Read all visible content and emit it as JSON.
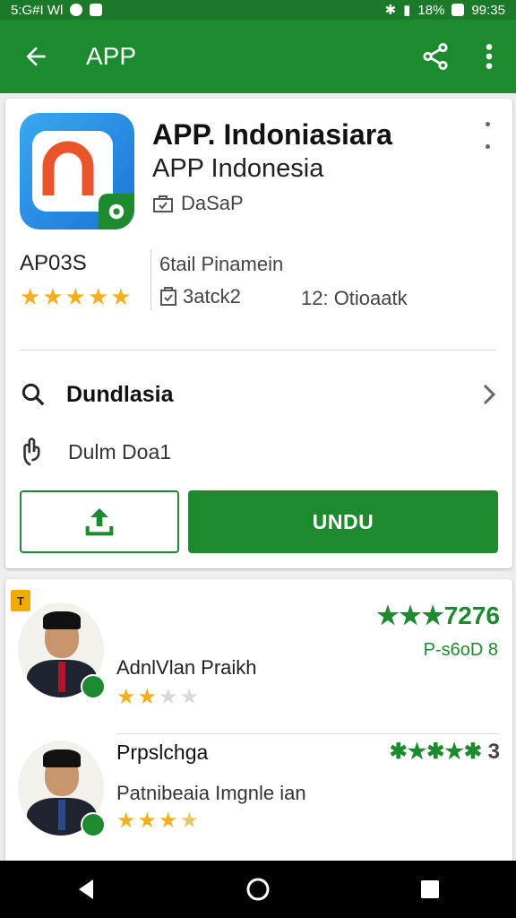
{
  "status_bar": {
    "left_text": "5:G#I Wl",
    "battery": "18%",
    "time": "99:35"
  },
  "app_bar": {
    "title": "APP"
  },
  "app": {
    "title": "APP. Indoniasiara",
    "subtitle": "APP Indonesia",
    "developer": "DaSaP",
    "rating_label": "AP03S",
    "rating_stars": 5,
    "info_label": "6tail Pinamein",
    "info_value": "3atck2",
    "info_extra": "12: Otioaatk"
  },
  "rows": {
    "search_label": "Dundlasia",
    "detail_label": "Dulm Doa1"
  },
  "buttons": {
    "install_label": "UNDU"
  },
  "reviews": {
    "section_tag": "T",
    "items": [
      {
        "name": "AdnlVlan Praikh",
        "text": "",
        "score": "7276",
        "score_sub": "P-s6oD 8",
        "stars": 2
      },
      {
        "name": "Prpslchga",
        "text": "Patnibeaia Imgnle ian",
        "score": "3",
        "score_sub": "",
        "stars": 3.5
      }
    ]
  },
  "colors": {
    "primary": "#1e8a30",
    "status": "#1b7a2a",
    "star": "#f2b01e"
  }
}
